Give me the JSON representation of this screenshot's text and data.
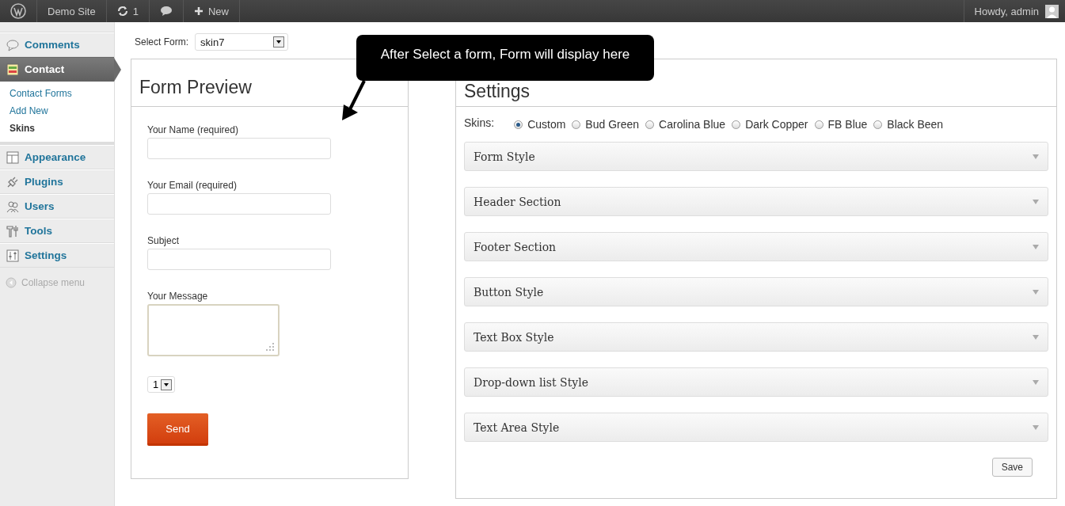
{
  "admin_bar": {
    "items": [
      {
        "kind": "logo"
      },
      {
        "kind": "site",
        "label": "Demo Site"
      },
      {
        "kind": "updates",
        "label": "1"
      },
      {
        "kind": "comments"
      },
      {
        "kind": "new",
        "label": "New"
      }
    ],
    "greeting": "Howdy, admin"
  },
  "sidebar": {
    "items": [
      {
        "kind": "comments",
        "label": "Comments",
        "selected": false
      },
      {
        "kind": "contact",
        "label": "Contact",
        "selected": true,
        "children": [
          {
            "label": "Contact Forms",
            "selected": false
          },
          {
            "label": "Add New",
            "selected": false
          },
          {
            "label": "Skins",
            "selected": true
          }
        ]
      },
      {
        "kind": "appearance",
        "label": "Appearance",
        "selected": false
      },
      {
        "kind": "plugins",
        "label": "Plugins",
        "selected": false
      },
      {
        "kind": "users",
        "label": "Users",
        "selected": false
      },
      {
        "kind": "tools",
        "label": "Tools",
        "selected": false
      },
      {
        "kind": "settings",
        "label": "Settings",
        "selected": false
      }
    ],
    "collapse": "Collapse menu"
  },
  "select_form": {
    "label": "Select Form:",
    "value": "skin7"
  },
  "callout": "After Select a form, Form will display here",
  "form_preview": {
    "title": "Form Preview",
    "fields": [
      {
        "kind": "input",
        "label": "Your Name (required)"
      },
      {
        "kind": "input",
        "label": "Your Email (required)"
      },
      {
        "kind": "input",
        "label": "Subject"
      },
      {
        "kind": "textarea",
        "label": "Your Message"
      },
      {
        "kind": "select",
        "value": "1"
      }
    ],
    "button": "Send"
  },
  "settings": {
    "title": "Settings",
    "skins_label": "Skins:",
    "skins": [
      {
        "label": "Custom",
        "selected": true
      },
      {
        "label": "Bud Green",
        "selected": false
      },
      {
        "label": "Carolina Blue",
        "selected": false
      },
      {
        "label": "Dark Copper",
        "selected": false
      },
      {
        "label": "FB Blue",
        "selected": false
      },
      {
        "label": "Black Been",
        "selected": false
      }
    ],
    "sections": [
      {
        "label": "Form Style",
        "expanded": false
      },
      {
        "label": "Header Section",
        "expanded": false
      },
      {
        "label": "Footer Section",
        "expanded": false
      },
      {
        "label": "Button Style",
        "expanded": false
      },
      {
        "label": "Text Box Style",
        "expanded": false
      },
      {
        "label": "Drop-down list Style",
        "expanded": false
      },
      {
        "label": "Text Area Style",
        "expanded": false
      }
    ],
    "save": "Save"
  }
}
